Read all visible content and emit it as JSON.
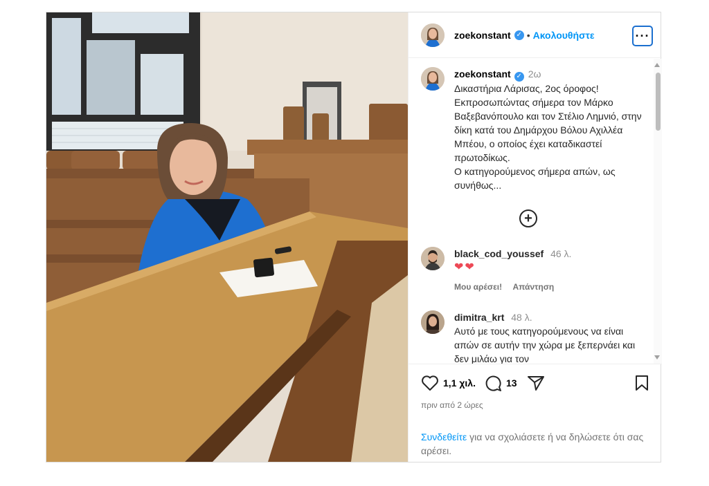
{
  "author": {
    "username": "zoekonstant",
    "verified_icon": "verified-badge-icon",
    "separator": "•",
    "follow_label": "Ακολουθήστε",
    "more_icon": "more-options-icon",
    "more_label": "···"
  },
  "caption": {
    "username": "zoekonstant",
    "time": "2ω",
    "text": "Δικαστήρια Λάρισας, 2ος όροφος!\nΕκπροσωπώντας σήμερα τον Μάρκο Βαξεβανόπουλο και τον Στέλιο Λημνιό, στην δίκη κατά του Δημάρχου Βόλου Αχιλλέα Μπέου, ο οποίος έχει καταδικαστεί πρωτοδίκως.\nΟ κατηγορούμενος σήμερα απών, ως συνήθως..."
  },
  "load_more_icon": "plus-circle-icon",
  "load_more_symbol": "+",
  "comments": [
    {
      "username": "black_cod_youssef",
      "time": "46 λ.",
      "text": "❤❤",
      "like_label": "Μου αρέσει!",
      "reply_label": "Απάντηση"
    },
    {
      "username": "dimitra_krt",
      "time": "48 λ.",
      "text": "Αυτό με τους κατηγορούμενους να είναι απών σε αυτήν την χώρα με ξεπερνάει και δεν μιλάω για τον"
    }
  ],
  "stats": {
    "likes": "1,1 χιλ.",
    "comments": "13",
    "like_icon": "heart-icon",
    "comment_icon": "comment-bubble-icon",
    "share_icon": "share-send-icon",
    "save_icon": "bookmark-icon"
  },
  "posted_ago": "πριν από 2 ώρες",
  "login_prompt": {
    "link": "Συνδεθείτε",
    "rest": " για να σχολιάσετε ή να δηλώσετε ότι σας αρέσει."
  },
  "colors": {
    "link_blue": "#0095f6",
    "verified_blue": "#3897f0",
    "blazer_blue": "#1e6fd0",
    "desk_wood": "#c7964f"
  }
}
